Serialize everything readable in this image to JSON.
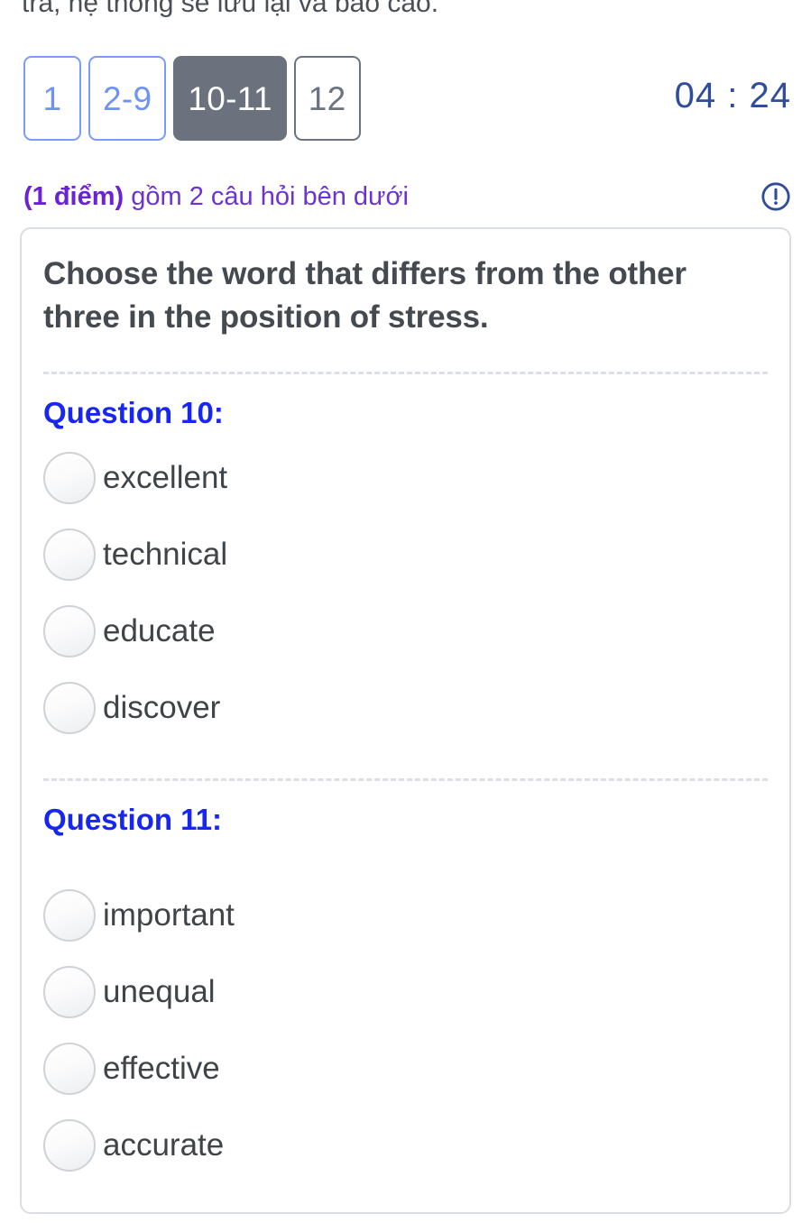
{
  "top_notice": "tra, hệ thống sẽ lưu lại và báo cáo.",
  "tabs": [
    {
      "label": "1",
      "state": "available"
    },
    {
      "label": "2-9",
      "state": "available"
    },
    {
      "label": "10-11",
      "state": "active"
    },
    {
      "label": "12",
      "state": "unvisited"
    }
  ],
  "timer": "04 : 24",
  "meta": {
    "points_label": "(1 điểm)",
    "description": "gồm 2 câu hỏi bên dưới",
    "alert_icon": "exclamation-circle-icon"
  },
  "card": {
    "passage": "Choose the word that differs from the other three in the position of stress.",
    "questions": [
      {
        "heading": "Question 10:",
        "options": [
          {
            "label": "excellent",
            "selected": false
          },
          {
            "label": "technical",
            "selected": false
          },
          {
            "label": "educate",
            "selected": false
          },
          {
            "label": "discover",
            "selected": false
          }
        ]
      },
      {
        "heading": "Question 11:",
        "options": [
          {
            "label": "important",
            "selected": false
          },
          {
            "label": "unequal",
            "selected": false
          },
          {
            "label": "effective",
            "selected": false
          },
          {
            "label": "accurate",
            "selected": false
          }
        ]
      }
    ]
  },
  "colors": {
    "tab_available_border": "#7b9bf7",
    "tab_available_text": "#6f92f6",
    "tab_active_bg": "#6b727d",
    "tab_unvisited": "#6b7280",
    "timer_text": "#2f4d9b",
    "meta_text": "#6b33d6",
    "question_heading": "#1726f0",
    "passage_text": "#444a50",
    "option_text": "#3f4449",
    "card_border": "#dadde1"
  }
}
